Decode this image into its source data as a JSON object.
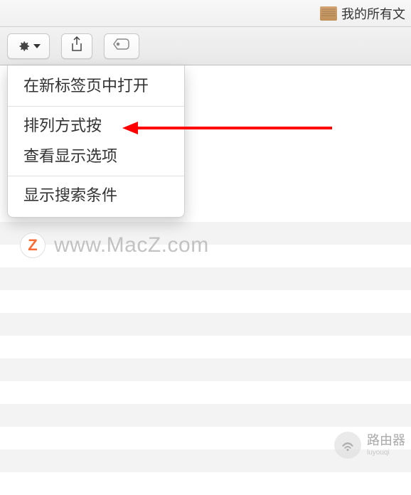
{
  "title": {
    "label": "我的所有文"
  },
  "toolbar": {
    "gear_name": "gear-icon",
    "chevron_name": "chevron-down-icon",
    "share_name": "share-icon",
    "tag_name": "tag-icon"
  },
  "menu": {
    "items": [
      "在新标签页中打开",
      "排列方式按",
      "查看显示选项",
      "显示搜索条件"
    ]
  },
  "watermark": {
    "logo": "Z",
    "text": "www.MacZ.com"
  },
  "router_watermark": {
    "main": "路由器",
    "sub": "luyouqi"
  },
  "colors": {
    "arrow": "#ff0000",
    "logo": "#ff6b35"
  }
}
